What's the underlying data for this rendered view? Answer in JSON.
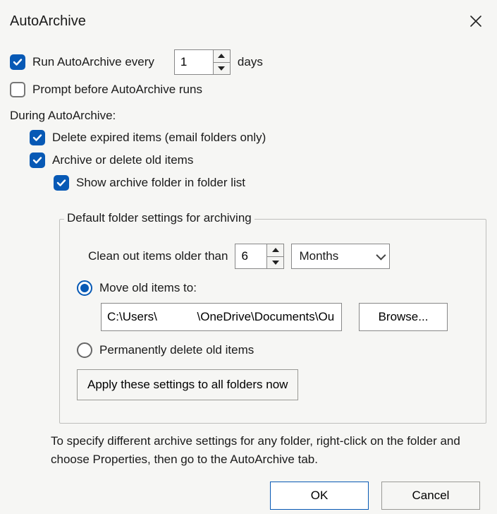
{
  "title": "AutoArchive",
  "run": {
    "label": "Run AutoArchive every",
    "value": "1",
    "unit": "days",
    "checked": true
  },
  "prompt": {
    "label": "Prompt before AutoArchive runs",
    "checked": false
  },
  "during_label": "During AutoArchive:",
  "delete_expired": {
    "label": "Delete expired items (email folders only)",
    "checked": true
  },
  "archive_old": {
    "label": "Archive or delete old items",
    "checked": true
  },
  "show_folder": {
    "label": "Show archive folder in folder list",
    "checked": true
  },
  "group": {
    "legend": "Default folder settings for archiving",
    "clean_label": "Clean out items older than",
    "clean_value": "6",
    "unit": "Months",
    "move_label": "Move old items to:",
    "move_selected": true,
    "path": "C:\\Users\\            \\OneDrive\\Documents\\Ou",
    "browse": "Browse...",
    "perm_label": "Permanently delete old items",
    "perm_selected": false,
    "apply": "Apply these settings to all folders now"
  },
  "hint": "To specify different archive settings for any folder, right-click on the folder and choose Properties, then go to the AutoArchive tab.",
  "ok": "OK",
  "cancel": "Cancel"
}
